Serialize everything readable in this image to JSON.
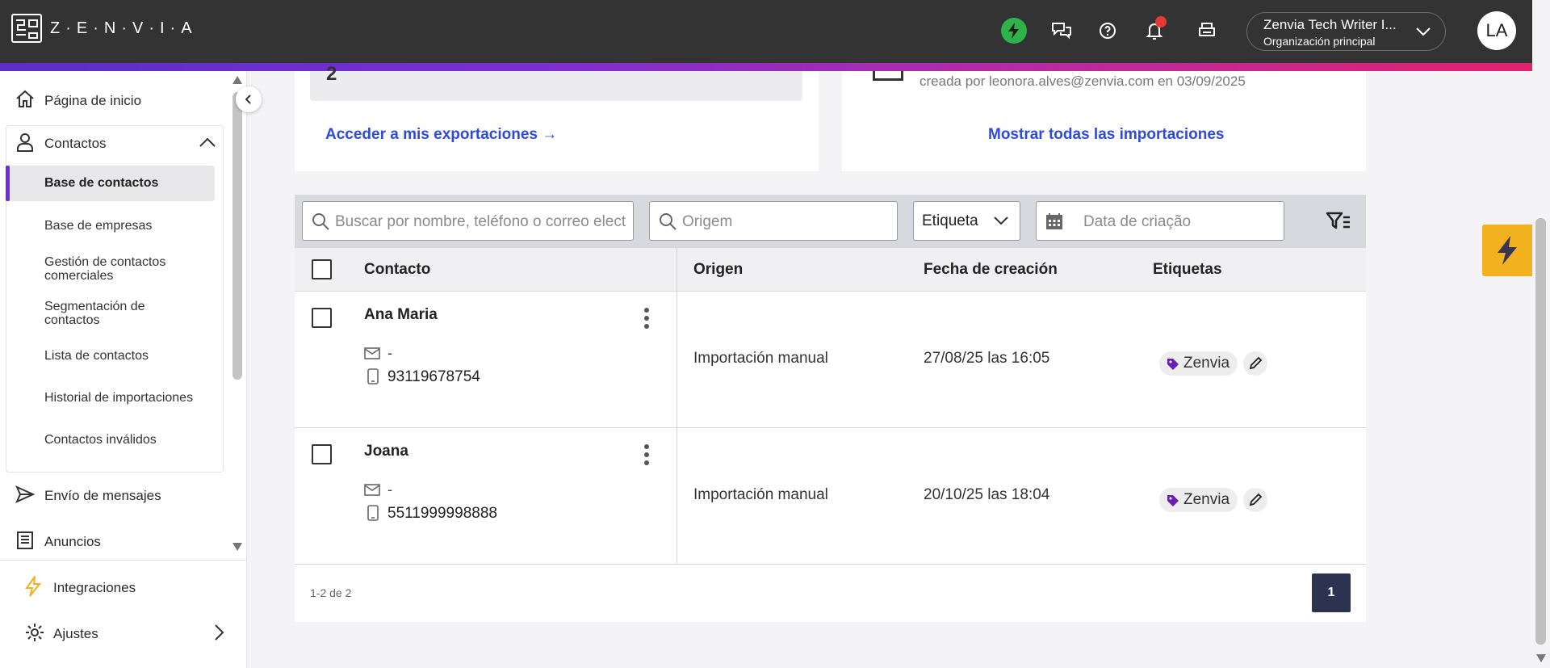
{
  "header": {
    "logo_text": "Z·E·N·V·I·A",
    "org_name": "Zenvia Tech Writer I...",
    "org_subtitle": "Organización principal",
    "avatar_initials": "LA"
  },
  "sidebar": {
    "home": "Página de inicio",
    "contacts": "Contactos",
    "contacts_items": [
      "Base de contactos",
      "Base de empresas",
      "Gestión de contactos comerciales",
      "Segmentación de contactos",
      "Lista de contactos",
      "Historial de importaciones",
      "Contactos inválidos"
    ],
    "messages": "Envío de mensajes",
    "ads": "Anuncios",
    "integrations": "Integraciones",
    "settings": "Ajustes"
  },
  "exports_card": {
    "count": "2",
    "link": "Acceder a mis exportaciones →"
  },
  "imports_card": {
    "created_by": "creada por leonora.alves@zenvia.com en 03/09/2025",
    "link": "Mostrar todas las importaciones"
  },
  "filters": {
    "search_placeholder": "Buscar por nombre, teléfono o correo elect",
    "origin_placeholder": "Origem",
    "tag_label": "Etiqueta",
    "date_placeholder": "Data de criação"
  },
  "table": {
    "headers": [
      "Contacto",
      "Origen",
      "Fecha de creación",
      "Etiquetas"
    ],
    "rows": [
      {
        "name": "Ana Maria",
        "email": "-",
        "phone": "93119678754",
        "origin": "Importación manual",
        "created": "27/08/25 las 16:05",
        "tag": "Zenvia"
      },
      {
        "name": "Joana",
        "email": "-",
        "phone": "5511999998888",
        "origin": "Importación manual",
        "created": "20/10/25 las 18:04",
        "tag": "Zenvia"
      }
    ],
    "pagination_text": "1-2 de 2",
    "current_page": "1"
  },
  "colors": {
    "accent_purple": "#6b2fd6",
    "link_blue": "#2e4bd8",
    "tag_purple": "#6a1fb0",
    "bolt_yellow": "#f2b21f",
    "status_green": "#2db34a"
  }
}
